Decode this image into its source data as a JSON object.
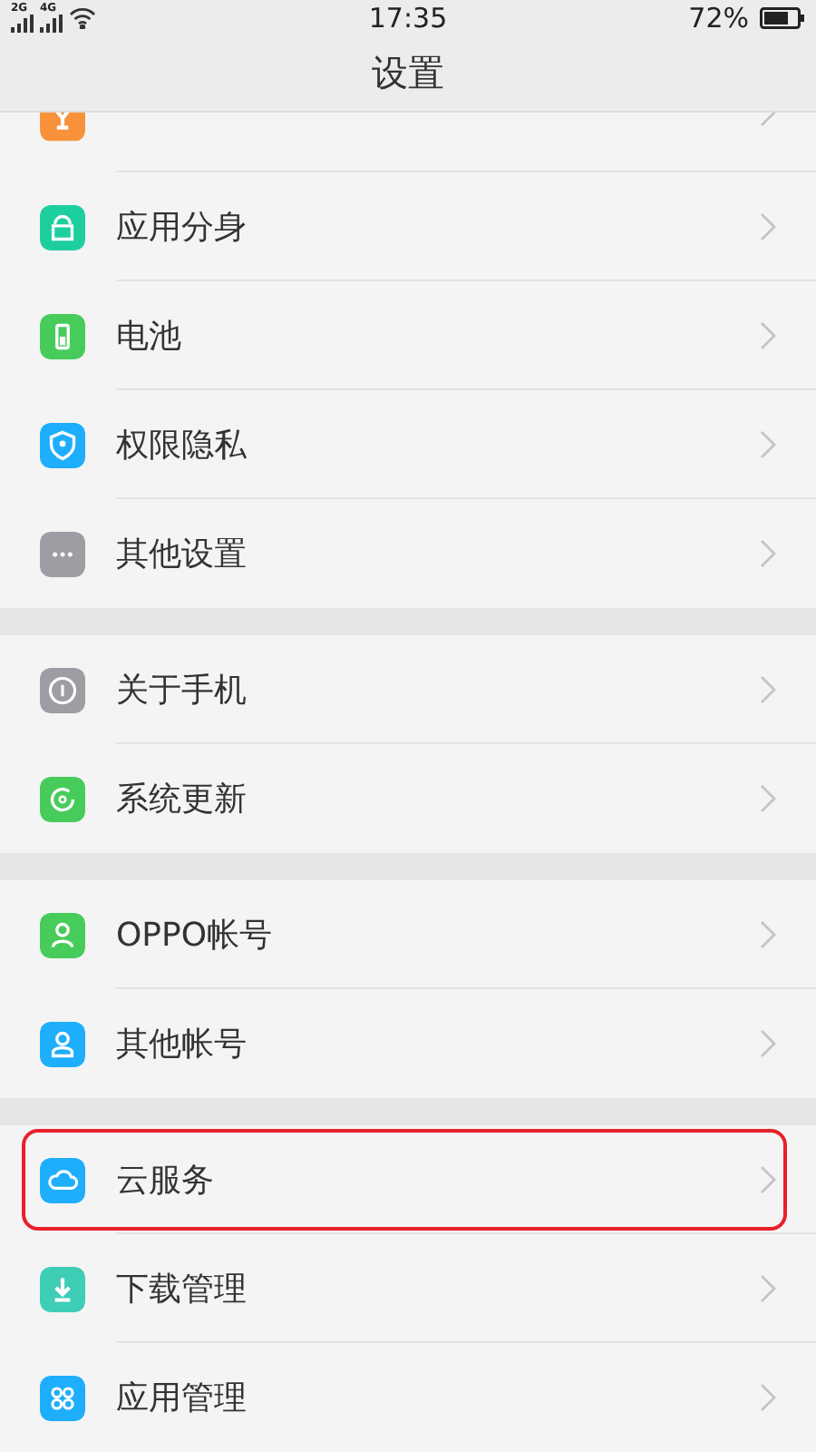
{
  "status_bar": {
    "network_1": "2G",
    "network_2": "4G",
    "time": "17:35",
    "battery": "72%"
  },
  "header": {
    "title": "设置"
  },
  "sections": [
    {
      "items": [
        {
          "color": "#f7923b",
          "highlighted": false
        },
        {
          "label": "应用分身",
          "color": "#1dcf9f",
          "highlighted": false
        },
        {
          "label": "电池",
          "color": "#47cc5b",
          "highlighted": false
        },
        {
          "label": "权限隐私",
          "color": "#1eaefc",
          "highlighted": false
        },
        {
          "label": "其他设置",
          "color": "#9c9ea3",
          "highlighted": false
        }
      ]
    },
    {
      "items": [
        {
          "label": "关于手机",
          "color": "#9c9ea3",
          "highlighted": false
        },
        {
          "label": "系统更新",
          "color": "#47cc5b",
          "highlighted": false
        }
      ]
    },
    {
      "items": [
        {
          "label": "OPPO帐号",
          "color": "#47cc5b",
          "highlighted": false
        },
        {
          "label": "其他帐号",
          "color": "#1eaefc",
          "highlighted": false
        }
      ]
    },
    {
      "items": [
        {
          "label": "云服务",
          "color": "#1eaefc",
          "highlighted": true
        },
        {
          "label": "下载管理",
          "color": "#3ecdb5",
          "highlighted": false
        },
        {
          "label": "应用管理",
          "color": "#1eaefc",
          "highlighted": false
        }
      ]
    }
  ]
}
